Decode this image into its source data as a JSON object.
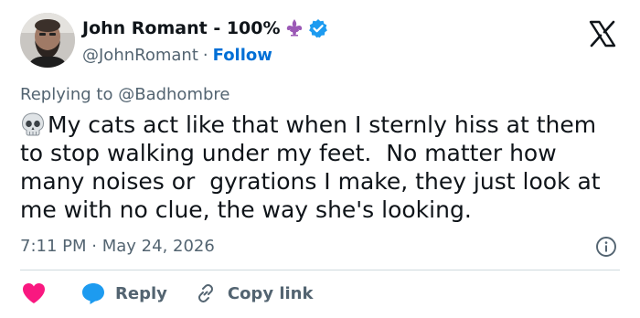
{
  "author": {
    "display_name": "John Romant - 100%",
    "handle": "@JohnRomant",
    "separator": "·",
    "follow_label": "Follow",
    "fleur_icon": "fleur-de-lis-icon",
    "verified_icon": "verified-badge-icon"
  },
  "reply_context": {
    "prefix": "Replying to",
    "mention": "@Badhombre"
  },
  "tweet": {
    "lines": [
      "My cats act like that when I sternly hiss at them",
      "to stop walking under my feet.  No matter how",
      "many noises or  gyrations I make, they just look at",
      "me with no clue, the way she's looking."
    ],
    "leading_emoji": "skull-emoji"
  },
  "meta": {
    "time": "7:11 PM",
    "separator": "·",
    "date": "May 24, 2026"
  },
  "actions": {
    "like_icon": "heart-icon",
    "reply_label": "Reply",
    "copy_link_label": "Copy link"
  },
  "colors": {
    "text": "#0f1419",
    "secondary": "#536471",
    "link": "#006fd6",
    "verified": "#1d9bf0",
    "heart": "#f91880",
    "fleur": "#9b59b6",
    "divider": "#cfd9de"
  }
}
